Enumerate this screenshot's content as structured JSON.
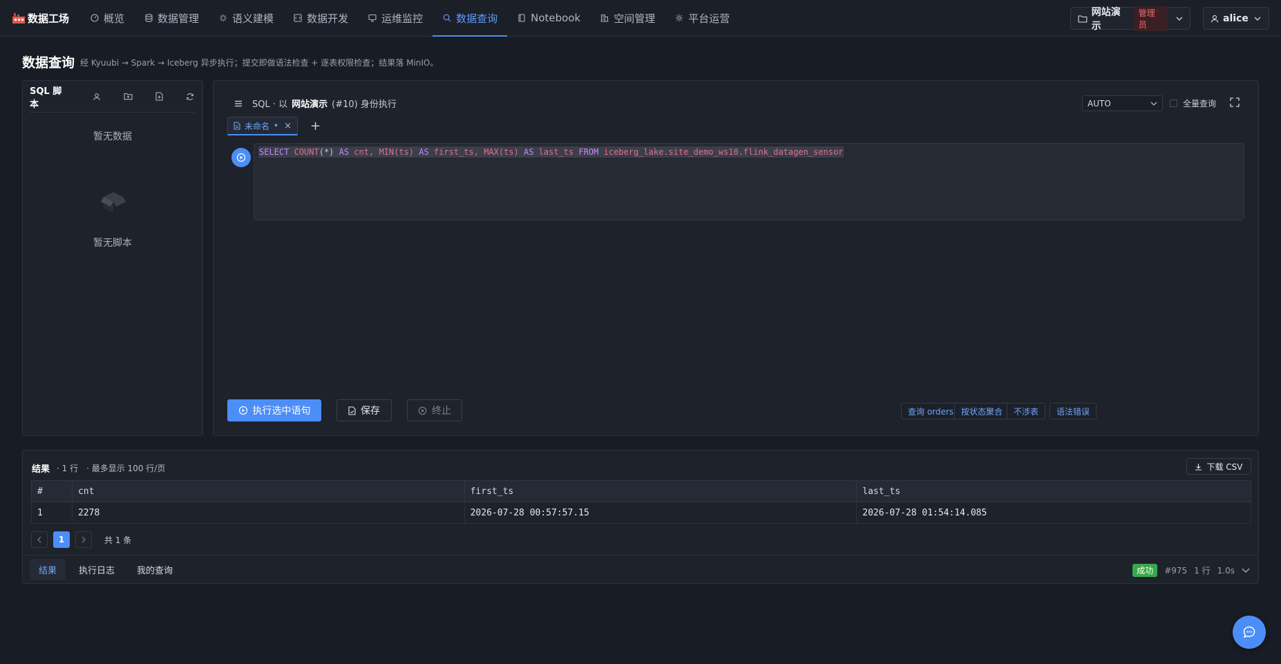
{
  "brand": {
    "title": "数据工场"
  },
  "nav": {
    "items": [
      {
        "label": "概览",
        "icon": "gauge-icon"
      },
      {
        "label": "数据管理",
        "icon": "database-icon"
      },
      {
        "label": "语义建模",
        "icon": "sparkle-icon"
      },
      {
        "label": "数据开发",
        "icon": "code-file-icon"
      },
      {
        "label": "运维监控",
        "icon": "monitor-icon"
      },
      {
        "label": "数据查询",
        "icon": "search-icon",
        "active": true
      },
      {
        "label": "Notebook",
        "icon": "notebook-icon"
      },
      {
        "label": "空间管理",
        "icon": "building-icon"
      },
      {
        "label": "平台运营",
        "icon": "gear-icon"
      }
    ],
    "workspace": {
      "label": "网站演示",
      "role": "管理员"
    },
    "user": {
      "name": "alice"
    }
  },
  "page": {
    "title": "数据查询",
    "subtitle": "经 Kyuubi → Spark → Iceberg 异步执行；提交即做语法检查 + 逐表权限检查；结果落 MinIO。"
  },
  "scripts_panel": {
    "title": "SQL 脚本",
    "empty_data": "暂无数据",
    "empty_scripts": "暂无脚本"
  },
  "editor": {
    "header_prefix": "SQL · 以",
    "workspace": "网站演示",
    "header_suffix": "(#10) 身份执行",
    "engine": "AUTO",
    "full_query_label": "全量查询",
    "tab_name": "未命名",
    "tab_dot": "•",
    "tokens": [
      {
        "t": "SELECT",
        "c": "kw"
      },
      {
        "t": " ",
        "c": "pn"
      },
      {
        "t": "COUNT",
        "c": "fn"
      },
      {
        "t": "(*) ",
        "c": "pn"
      },
      {
        "t": "AS",
        "c": "kw"
      },
      {
        "t": " cnt, ",
        "c": "id"
      },
      {
        "t": "MIN",
        "c": "fn"
      },
      {
        "t": "(ts) ",
        "c": "id"
      },
      {
        "t": "AS",
        "c": "kw"
      },
      {
        "t": " first_ts, ",
        "c": "id"
      },
      {
        "t": "MAX",
        "c": "fn"
      },
      {
        "t": "(ts) ",
        "c": "id"
      },
      {
        "t": "AS",
        "c": "kw"
      },
      {
        "t": " last_ts ",
        "c": "id"
      },
      {
        "t": "FROM",
        "c": "kw"
      },
      {
        "t": " iceberg_lake.site_demo_ws10.flink_datagen_sensor",
        "c": "id"
      }
    ],
    "run_label": "执行选中语句",
    "save_label": "保存",
    "stop_label": "终止",
    "snippets": [
      "查询 orders",
      "按状态聚合",
      "不涉表",
      "语法错误"
    ]
  },
  "results": {
    "title": "结果",
    "row_count": "· 1 行",
    "page_size": "· 最多显示 100 行/页",
    "download_label": "下载 CSV",
    "columns": [
      "#",
      "cnt",
      "first_ts",
      "last_ts"
    ],
    "rows": [
      [
        "1",
        "2278",
        "2026-07-28 00:57:57.15",
        "2026-07-28 01:54:14.085"
      ]
    ],
    "pagination": {
      "current": "1",
      "total": "共 1 条"
    },
    "footer_tabs": [
      "结果",
      "执行日志",
      "我的查询"
    ],
    "status": {
      "label": "成功",
      "id": "#975",
      "rows": "1 行",
      "time": "1.0s"
    }
  },
  "colors": {
    "accent": "#4c8ef7",
    "success": "#3aa84a",
    "danger": "#f06b6b"
  }
}
